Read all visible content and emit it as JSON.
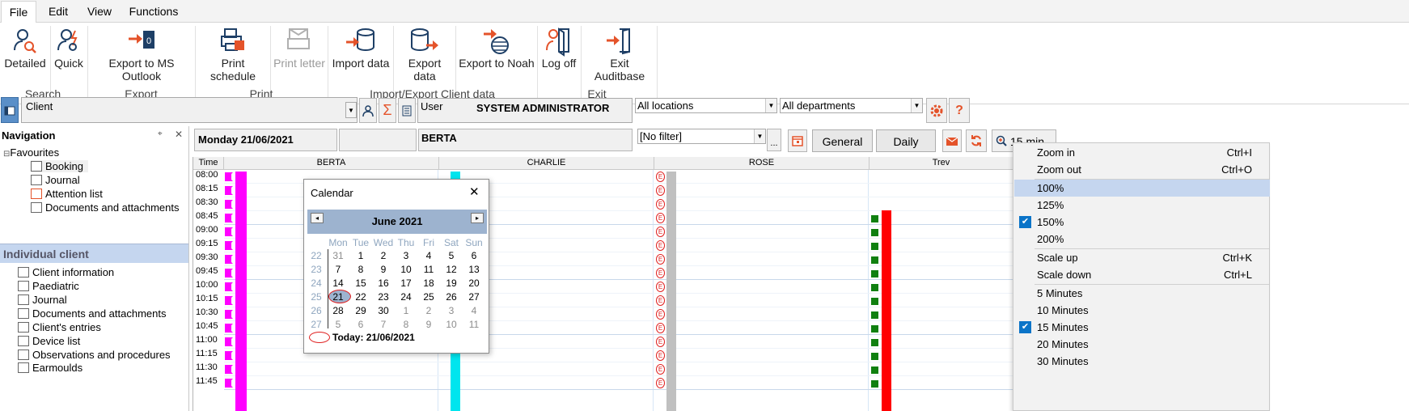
{
  "menu": {
    "file": "File",
    "edit": "Edit",
    "view": "View",
    "functions": "Functions"
  },
  "ribbon": {
    "detailed": "Detailed",
    "quick": "Quick",
    "export_outlook": "Export to MS Outlook",
    "print_schedule": "Print schedule",
    "print_letter": "Print letter",
    "import_data": "Import data",
    "export_data": "Export data",
    "export_noah": "Export to Noah",
    "log_off": "Log off",
    "exit_auditbase": "Exit Auditbase",
    "groups": {
      "search": "Search",
      "export": "Export",
      "print": "Print",
      "import_export": "Import/Export Client data",
      "exit": "Exit"
    }
  },
  "toolbar": {
    "client_select": "Client",
    "user_label": "User",
    "user_name": "SYSTEM ADMINISTRATOR",
    "locations": "All locations",
    "departments": "All departments",
    "filter": "[No filter]",
    "ellipsis": "...",
    "sigma": "Σ",
    "help": "?",
    "date": "Monday 21/06/2021",
    "resource": "BERTA",
    "general_btn": "General",
    "daily_btn": "Daily",
    "interval": "15 min"
  },
  "navigation": {
    "title": "Navigation",
    "pin": "⌖",
    "close": "✕",
    "favourites": "Favourites",
    "fav_items": [
      "Booking",
      "Journal",
      "Attention list",
      "Documents and attachments"
    ],
    "individual_title": "Individual client",
    "client_items": [
      "Client information",
      "Paediatric",
      "Journal",
      "Documents and attachments",
      "Client's entries",
      "Device list",
      "Observations and procedures",
      "Earmoulds"
    ]
  },
  "schedule": {
    "time_header": "Time",
    "columns": [
      "BERTA",
      "CHARLIE",
      "ROSE",
      "Trev"
    ],
    "times": [
      "08:00",
      "08:15",
      "08:30",
      "08:45",
      "09:00",
      "09:15",
      "09:30",
      "09:45",
      "10:00",
      "10:15",
      "10:30",
      "10:45",
      "11:00",
      "11:15",
      "11:30",
      "11:45"
    ],
    "colors": {
      "berta": "#ff00ff",
      "charlie": "#00e5ee",
      "rose_gray": "#c0c0c0",
      "trev_red": "#ff0000",
      "trev_green": "#108010"
    }
  },
  "calendar": {
    "title": "Calendar",
    "close": "✕",
    "month": "June 2021",
    "prev": "◂",
    "next": "▸",
    "weekdays": [
      "Mon",
      "Tue",
      "Wed",
      "Thu",
      "Fri",
      "Sat",
      "Sun"
    ],
    "weeks": [
      {
        "wk": "22",
        "days": [
          "31",
          "1",
          "2",
          "3",
          "4",
          "5",
          "6"
        ]
      },
      {
        "wk": "23",
        "days": [
          "7",
          "8",
          "9",
          "10",
          "11",
          "12",
          "13"
        ]
      },
      {
        "wk": "24",
        "days": [
          "14",
          "15",
          "16",
          "17",
          "18",
          "19",
          "20"
        ]
      },
      {
        "wk": "25",
        "days": [
          "21",
          "22",
          "23",
          "24",
          "25",
          "26",
          "27"
        ]
      },
      {
        "wk": "26",
        "days": [
          "28",
          "29",
          "30",
          "1",
          "2",
          "3",
          "4"
        ]
      },
      {
        "wk": "27",
        "days": [
          "5",
          "6",
          "7",
          "8",
          "9",
          "10",
          "11"
        ]
      }
    ],
    "today": "Today: 21/06/2021"
  },
  "zoom_menu": {
    "zoom_in": "Zoom in",
    "zoom_in_sc": "Ctrl+I",
    "zoom_out": "Zoom out",
    "zoom_out_sc": "Ctrl+O",
    "p100": "100%",
    "p125": "125%",
    "p150": "150%",
    "p200": "200%",
    "scale_up": "Scale up",
    "scale_up_sc": "Ctrl+K",
    "scale_down": "Scale down",
    "scale_down_sc": "Ctrl+L",
    "m5": "5 Minutes",
    "m10": "10 Minutes",
    "m15": "15 Minutes",
    "m20": "20 Minutes",
    "m30": "30 Minutes",
    "check": "✔"
  }
}
